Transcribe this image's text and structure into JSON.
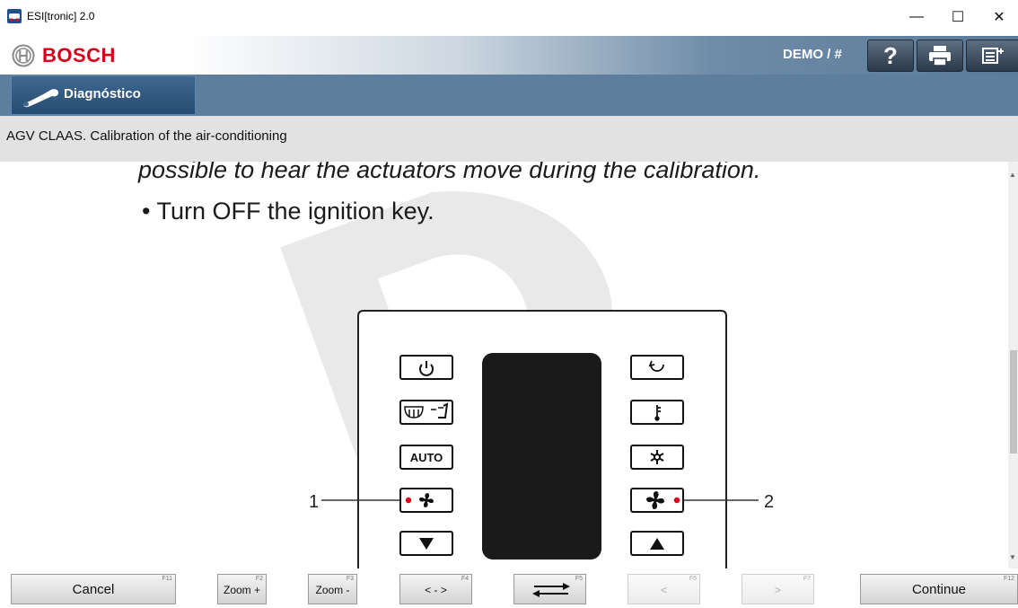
{
  "window": {
    "title": "ESI[tronic] 2.0",
    "minimize_glyph": "—",
    "maximize_glyph": "☐",
    "close_glyph": "✕"
  },
  "header": {
    "brand": "BOSCH",
    "user": "DEMO / #",
    "help_glyph": "?",
    "buttons": [
      "help-icon",
      "print-icon",
      "export-icon"
    ]
  },
  "nav": {
    "tab_label": "Diagnóstico",
    "tab_icon": "wrench-icon"
  },
  "breadcrumb": {
    "text": "AGV CLAAS. Calibration of the air-conditioning"
  },
  "document": {
    "line1": "possible to hear the actuators move during the calibration.",
    "line2": "• Turn OFF the ignition key.",
    "panel": {
      "left_buttons": [
        "power-icon",
        "defrost-icon",
        "AUTO",
        "fan-icon",
        "down-arrow-icon"
      ],
      "right_buttons": [
        "recirculation-icon",
        "temperature-icon",
        "ac-icon",
        "fan-icon",
        "up-arrow-icon"
      ],
      "auto_label": "AUTO",
      "callout_1": "1",
      "callout_2": "2",
      "dot_color": "#e0001b"
    }
  },
  "toolbar": {
    "cancel": {
      "label": "Cancel",
      "fkey": "F11"
    },
    "zoom_in": {
      "label": "Zoom +",
      "fkey": "F2"
    },
    "zoom_out": {
      "label": "Zoom -",
      "fkey": "F3"
    },
    "fit": {
      "label": "< - >",
      "fkey": "F4"
    },
    "swap": {
      "label": "",
      "fkey": "F5"
    },
    "prev": {
      "label": "<",
      "fkey": "F6"
    },
    "next": {
      "label": ">",
      "fkey": "F7"
    },
    "continue": {
      "label": "Continue",
      "fkey": "F12"
    }
  },
  "colors": {
    "bosch_red": "#d40019",
    "nav_blue": "#5e7e9d",
    "tab_blue": "#274b70"
  }
}
